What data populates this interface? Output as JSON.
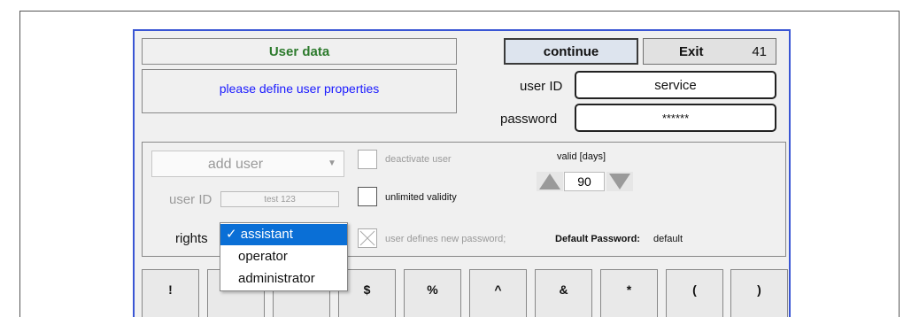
{
  "header": {
    "title": "User data",
    "message": "please define user properties",
    "continue_label": "continue",
    "exit_label": "Exit",
    "exit_count": "41"
  },
  "login": {
    "user_id_label": "user ID",
    "user_id_value": "service",
    "password_label": "password",
    "password_value": "******"
  },
  "user_group": {
    "mode_select": "add user",
    "deactivate_label": "deactivate user",
    "valid_label": "valid [days]",
    "valid_days": "90",
    "user_id_label": "user ID",
    "user_id_value": "test 123",
    "unlimited_label": "unlimited validity",
    "rights_label": "rights",
    "new_password_label": "user defines new password;",
    "default_password_label": "Default Password:",
    "default_password_value": "default"
  },
  "rights_dropdown": {
    "options": [
      {
        "label": "✓ assistant",
        "selected": true
      },
      {
        "label": "operator",
        "selected": false
      },
      {
        "label": "administrator",
        "selected": false
      }
    ]
  },
  "keypad": {
    "keys": [
      "!",
      "",
      "",
      "$",
      "%",
      "^",
      "&",
      "*",
      "(",
      ")"
    ]
  },
  "colors": {
    "title_green": "#2c7a2c",
    "message_blue": "#1a1aff",
    "frame_blue": "#3a56d4",
    "selection_blue": "#0a6fd6"
  }
}
